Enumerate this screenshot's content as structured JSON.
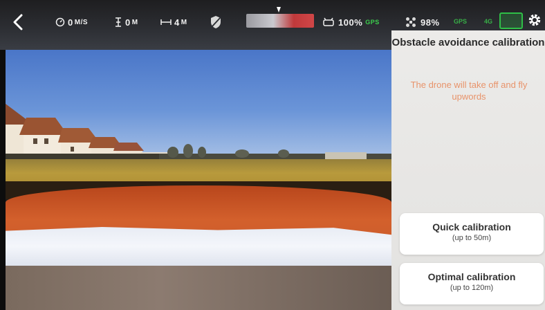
{
  "topbar": {
    "speed_value": "0",
    "speed_unit": "M/S",
    "altitude_value": "0",
    "altitude_unit": "M",
    "distance_value": "4",
    "distance_unit": "M",
    "controller_battery": "100%",
    "gps_label": "GPS",
    "drone_battery": "98%",
    "faded_label_1": "GPS",
    "faded_label_2": "4G"
  },
  "panel": {
    "title": "Obstacle avoidance calibration",
    "description": "The drone will take off and fly upwords",
    "quick_button": {
      "label": "Quick calibration",
      "sub": "(up to 50m)"
    },
    "optimal_button": {
      "label": "Optimal calibration",
      "sub": "(up to 120m)"
    }
  },
  "colors": {
    "accent_orange": "#e8936a",
    "gps_green": "#3ccf4e",
    "panel_bg": "#ecebe9"
  },
  "icons": [
    "chevron-left-icon",
    "speedometer-icon",
    "altitude-icon",
    "distance-icon",
    "shield-icon",
    "controller-icon",
    "drone-icon",
    "gear-icon"
  ]
}
